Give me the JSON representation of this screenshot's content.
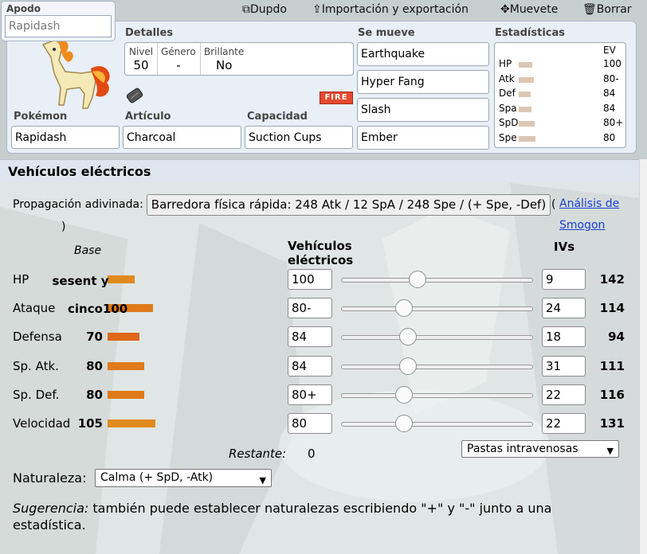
{
  "nickname": {
    "label": "Apodo",
    "placeholder": "Rapidash"
  },
  "menu": {
    "duplicate": "Dupdo",
    "import_export": "Importación y exportación",
    "move": "Muevete",
    "delete": "Borrar"
  },
  "details": {
    "label": "Detalles",
    "level_label": "Nivel",
    "level": "50",
    "gender_label": "Género",
    "gender": "-",
    "shiny_label": "Brillante",
    "shiny": "No"
  },
  "moves": {
    "label": "Se mueve",
    "items": [
      "Earthquake",
      "Hyper Fang",
      "Slash",
      "Ember"
    ]
  },
  "stats_summary": {
    "label": "Estadísticas",
    "ev_header": "EV",
    "rows": [
      {
        "name": "HP",
        "ev": "100",
        "level": 0.33
      },
      {
        "name": "Atk",
        "ev": "80-",
        "level": 0.38
      },
      {
        "name": "Def",
        "ev": "84",
        "level": 0.3
      },
      {
        "name": "Spa",
        "ev": "84",
        "level": 0.32
      },
      {
        "name": "SpD",
        "ev": "80+",
        "level": 0.39
      },
      {
        "name": "Spe",
        "ev": "80",
        "level": 0.42
      }
    ]
  },
  "pokemon": {
    "label": "Pokémon",
    "value": "Rapidash",
    "type_badge": "FIRE"
  },
  "item": {
    "label": "Artículo",
    "value": "Charcoal"
  },
  "ability": {
    "label": "Capacidad",
    "value": "Suction Cups"
  },
  "section": {
    "title": "Vehículos eléctricos"
  },
  "spread": {
    "label": "Propagación adivinada:",
    "button": "Barredora física rápida: 248 Atk / 12 SpA / 248 Spe / (+ Spe, -Def)",
    "paren_open": "(",
    "link": "Análisis de Smogon",
    "paren_close": ")"
  },
  "columns": {
    "base": "Base",
    "evs": "Vehículos eléctricos",
    "ivs": "IVs"
  },
  "overflow_text": {
    "hp": "sesent y",
    "atk": "cinco100"
  },
  "stat_rows": [
    {
      "name": "HP",
      "base": "",
      "base_value": 60,
      "ev": "100",
      "slider": 0.4,
      "iv": "9",
      "total": "142",
      "color": "#e08a1e"
    },
    {
      "name": "Ataque",
      "base": "",
      "base_value": 100,
      "ev": "80-",
      "slider": 0.33,
      "iv": "24",
      "total": "114",
      "color": "#e07a1a"
    },
    {
      "name": "Defensa",
      "base": "70",
      "base_value": 70,
      "ev": "84",
      "slider": 0.35,
      "iv": "18",
      "total": "94",
      "color": "#de6818"
    },
    {
      "name": "Sp. Atk.",
      "base": "80",
      "base_value": 80,
      "ev": "84",
      "slider": 0.35,
      "iv": "31",
      "total": "111",
      "color": "#e07a1a"
    },
    {
      "name": "Sp. Def.",
      "base": "80",
      "base_value": 80,
      "ev": "80+",
      "slider": 0.33,
      "iv": "22",
      "total": "116",
      "color": "#e07a1a"
    },
    {
      "name": "Velocidad",
      "base": "105",
      "base_value": 105,
      "ev": "80",
      "slider": 0.33,
      "iv": "22",
      "total": "131",
      "color": "#e08a1e"
    }
  ],
  "remaining": {
    "label": "Restante:",
    "value": "0"
  },
  "ivs_preset": {
    "value": "Pastas intravenosas"
  },
  "nature": {
    "label": "Naturaleza:",
    "value": "Calma (+ SpD, -Atk)"
  },
  "hint": {
    "prefix": "Sugerencia:",
    "text": " también puede establecer naturalezas escribiendo \"+\" y \"-\" junto a una estadística."
  }
}
